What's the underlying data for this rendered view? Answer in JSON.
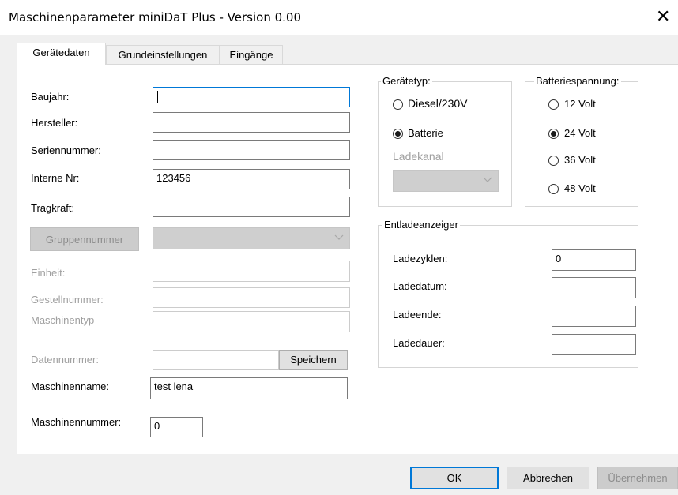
{
  "window": {
    "title": "Maschinenparameter miniDaT Plus - Version 0.00",
    "close_glyph": "✕"
  },
  "tabs": [
    {
      "label": "Gerätedaten",
      "active": true
    },
    {
      "label": "Grundeinstellungen",
      "active": false
    },
    {
      "label": "Eingänge",
      "active": false
    }
  ],
  "form": {
    "baujahr": {
      "label": "Baujahr:",
      "value": ""
    },
    "hersteller": {
      "label": "Hersteller:",
      "value": ""
    },
    "seriennummer": {
      "label": "Seriennummer:",
      "value": ""
    },
    "interne_nr": {
      "label": "Interne Nr:",
      "value": "123456"
    },
    "tragkraft": {
      "label": "Tragkraft:",
      "value": ""
    },
    "gruppennummer": {
      "button_label": "Gruppennummer",
      "value": ""
    },
    "einheit": {
      "label": "Einheit:",
      "value": ""
    },
    "gestellnummer": {
      "label": "Gestellnummer:",
      "value": ""
    },
    "maschinentyp": {
      "label": "Maschinentyp",
      "value": ""
    },
    "datennummer": {
      "label": "Datennummer:",
      "value": "",
      "save_label": "Speichern"
    },
    "maschinenname": {
      "label": "Maschinenname:",
      "value": "test lena"
    },
    "maschinennummer": {
      "label": "Maschinennummer:",
      "value": "0"
    }
  },
  "geraetetyp": {
    "legend": "Gerätetyp:",
    "options": [
      {
        "label": "Diesel/230V",
        "selected": false
      },
      {
        "label": "Batterie",
        "selected": true
      }
    ],
    "ladekanal": {
      "label": "Ladekanal",
      "value": ""
    }
  },
  "batteriespannung": {
    "legend": "Batteriespannung:",
    "options": [
      {
        "label": "12 Volt",
        "selected": false
      },
      {
        "label": "24 Volt",
        "selected": true
      },
      {
        "label": "36 Volt",
        "selected": false
      },
      {
        "label": "48 Volt",
        "selected": false
      }
    ]
  },
  "entladeanzeiger": {
    "legend": "Entladeanzeiger",
    "ladezyklen": {
      "label": "Ladezyklen:",
      "value": "0"
    },
    "ladedatum": {
      "label": "Ladedatum:",
      "value": ""
    },
    "ladeende": {
      "label": "Ladeende:",
      "value": ""
    },
    "ladedauer": {
      "label": "Ladedauer:",
      "value": ""
    }
  },
  "footer": {
    "ok_label": "OK",
    "cancel_label": "Abbrechen",
    "apply_label": "Übernehmen"
  },
  "colors": {
    "focus_border": "#0078d7",
    "disabled_text": "#a0a0a0"
  },
  "icons": {
    "close": "close-icon",
    "dropdown": "chevron-down-icon"
  }
}
